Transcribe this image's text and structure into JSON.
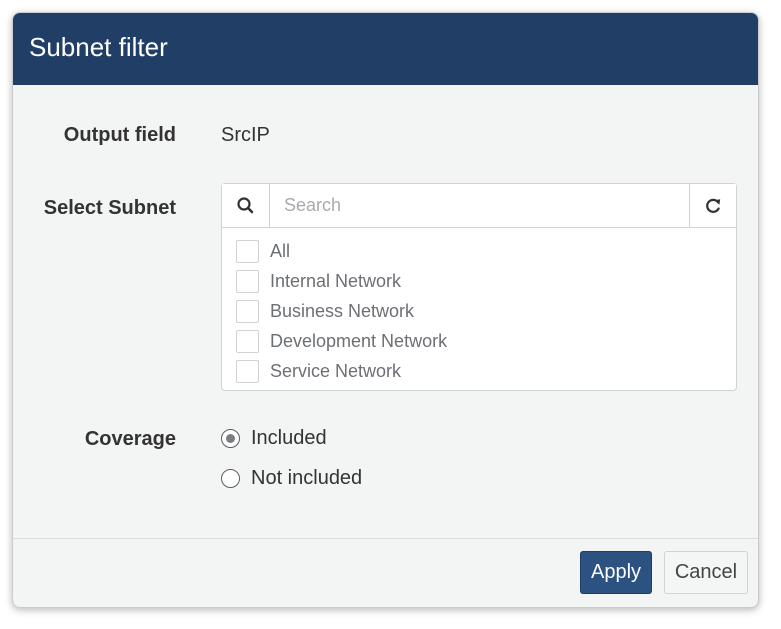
{
  "dialog": {
    "title": "Subnet filter"
  },
  "output_field": {
    "label": "Output field",
    "value": "SrcIP"
  },
  "select_subnet": {
    "label": "Select Subnet",
    "search_placeholder": "Search",
    "search_icon": "search-icon",
    "refresh_icon": "refresh-icon",
    "options": [
      {
        "label": "All",
        "checked": false
      },
      {
        "label": "Internal Network",
        "checked": false
      },
      {
        "label": "Business Network",
        "checked": false
      },
      {
        "label": "Development Network",
        "checked": false
      },
      {
        "label": "Service Network",
        "checked": false
      }
    ]
  },
  "coverage": {
    "label": "Coverage",
    "options": [
      {
        "label": "Included",
        "selected": true
      },
      {
        "label": "Not included",
        "selected": false
      }
    ]
  },
  "footer": {
    "apply_label": "Apply",
    "cancel_label": "Cancel"
  },
  "colors": {
    "header_bg": "#213f66",
    "primary_button": "#2c5282",
    "dialog_bg": "#f3f4f4"
  }
}
